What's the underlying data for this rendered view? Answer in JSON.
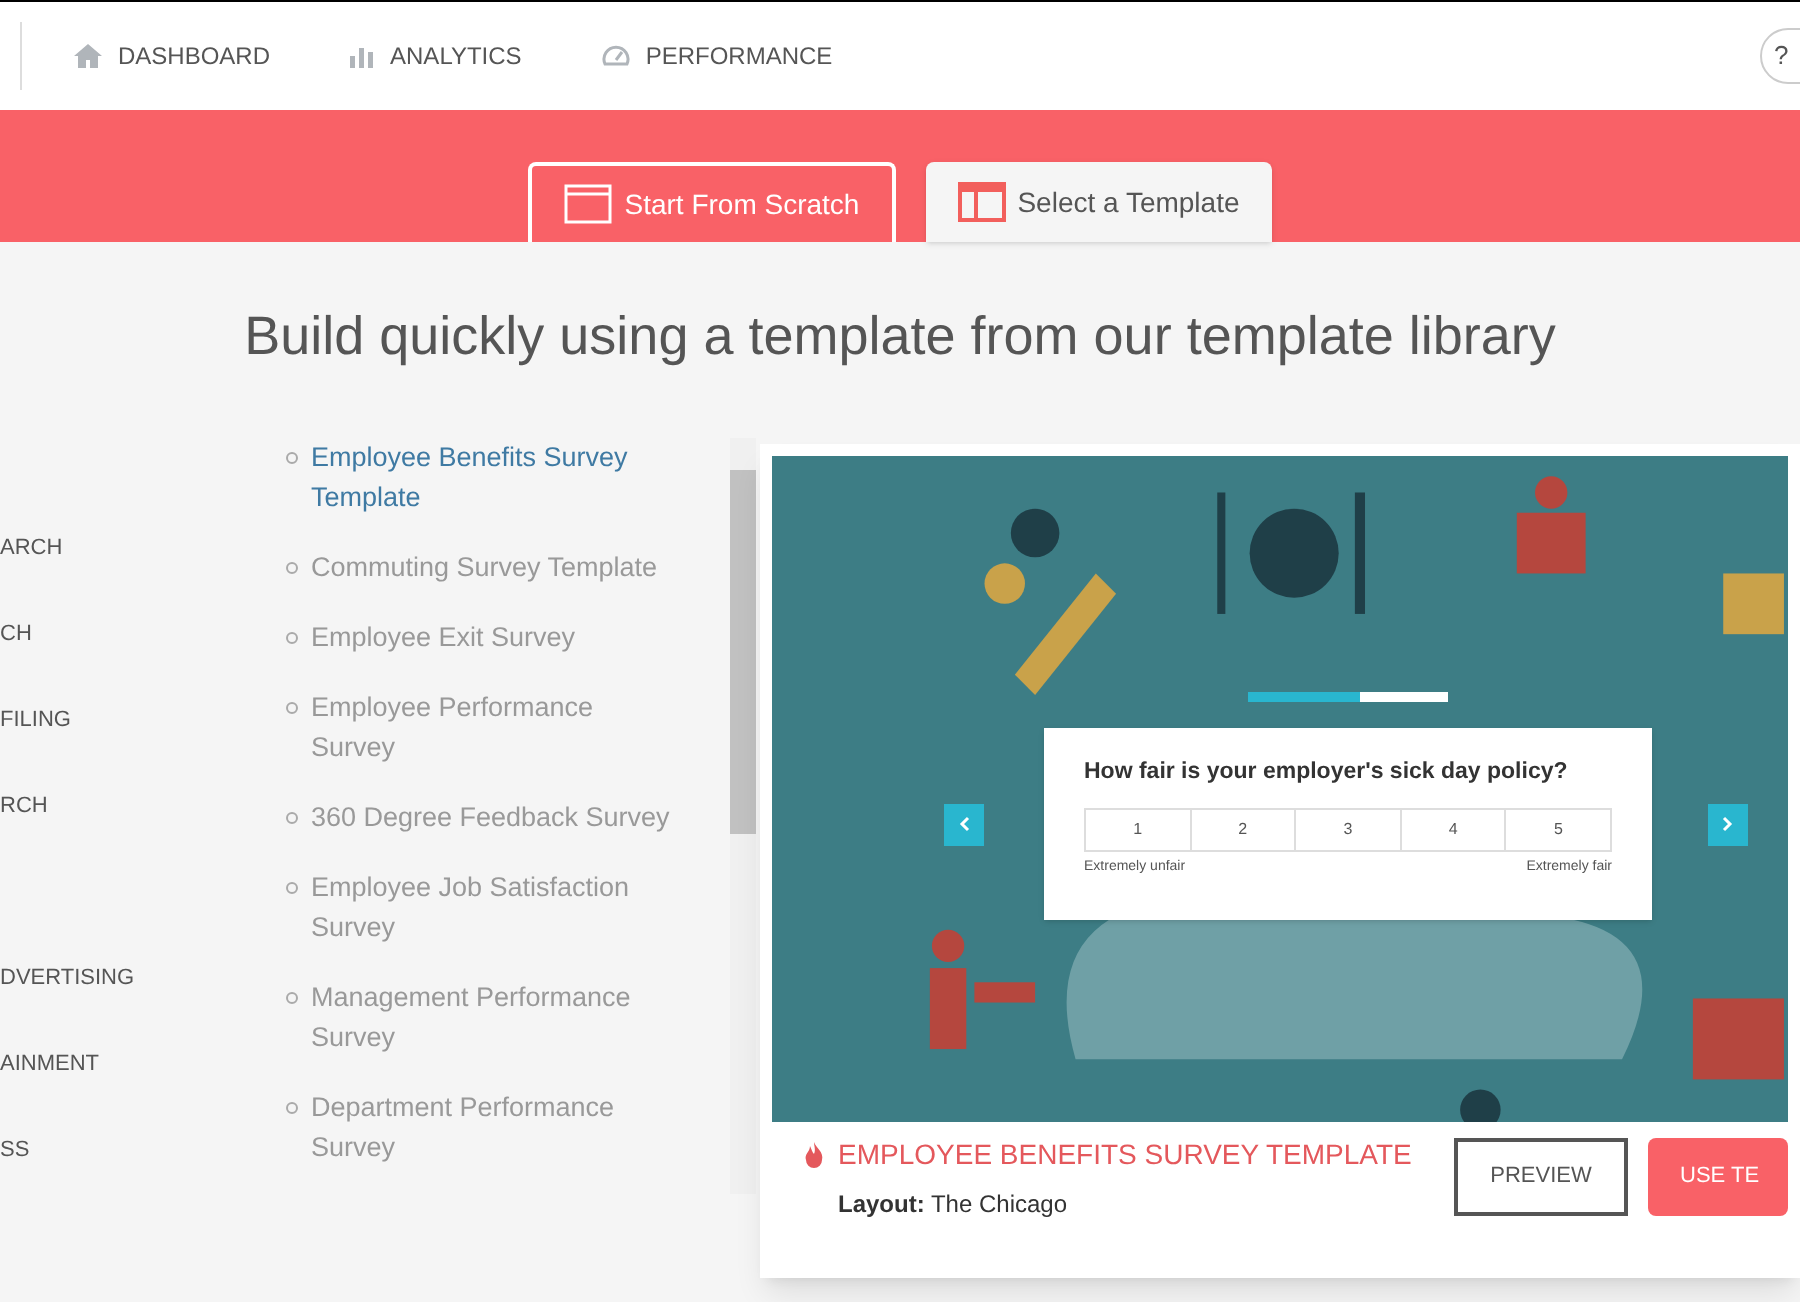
{
  "nav": {
    "items": [
      {
        "label": "DASHBOARD"
      },
      {
        "label": "ANALYTICS"
      },
      {
        "label": "PERFORMANCE"
      }
    ],
    "help": "?"
  },
  "tabs": [
    {
      "label": "Start From Scratch",
      "selected": false
    },
    {
      "label": "Select a Template",
      "selected": true
    }
  ],
  "heading": "Build quickly using a template from our template library",
  "categories": [
    "ARCH",
    "CH",
    "FILING",
    "RCH",
    "DVERTISING",
    "AINMENT",
    "SS"
  ],
  "templates": [
    {
      "label": "Employee Benefits Survey Template",
      "selected": true
    },
    {
      "label": "Commuting Survey Template",
      "selected": false
    },
    {
      "label": "Employee Exit Survey",
      "selected": false
    },
    {
      "label": "Employee Performance Survey",
      "selected": false
    },
    {
      "label": "360 Degree Feedback Survey",
      "selected": false
    },
    {
      "label": "Employee Job Satisfaction Survey",
      "selected": false
    },
    {
      "label": "Management Performance Survey",
      "selected": false
    },
    {
      "label": "Department Performance Survey",
      "selected": false
    }
  ],
  "preview": {
    "survey": {
      "question": "How fair is your employer's sick day policy?",
      "level": 0.56,
      "options": [
        "1",
        "2",
        "3",
        "4",
        "5"
      ],
      "low_label": "Extremely unfair",
      "high_label": "Extremely fair"
    },
    "title": "EMPLOYEE BENEFITS SURVEY TEMPLATE",
    "layout_label": "Layout:",
    "layout_value": "The Chicago",
    "buttons": [
      {
        "label": "PREVIEW",
        "kind": "outline"
      },
      {
        "label": "USE TE",
        "kind": "primary"
      }
    ]
  }
}
